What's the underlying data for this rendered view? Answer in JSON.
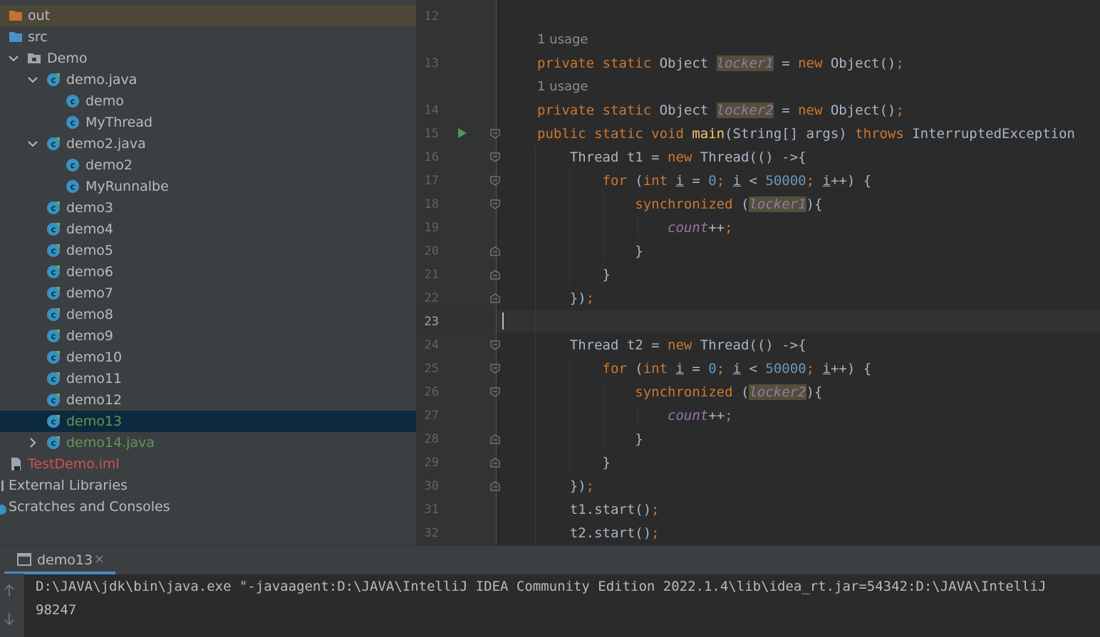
{
  "project_tree": {
    "items": [
      {
        "label": "out",
        "icon": "folder-orange-icon"
      },
      {
        "label": "src",
        "icon": "folder-blue-icon"
      },
      {
        "label": "Demo",
        "icon": "package-icon"
      },
      {
        "label": "demo.java",
        "icon": "java-class-icon"
      },
      {
        "label": "demo",
        "icon": "class-icon"
      },
      {
        "label": "MyThread",
        "icon": "class-icon"
      },
      {
        "label": "demo2.java",
        "icon": "java-class-icon"
      },
      {
        "label": "demo2",
        "icon": "class-icon"
      },
      {
        "label": "MyRunnalbe",
        "icon": "class-icon"
      },
      {
        "label": "demo3",
        "icon": "java-class-icon"
      },
      {
        "label": "demo4",
        "icon": "java-class-icon"
      },
      {
        "label": "demo5",
        "icon": "java-class-icon"
      },
      {
        "label": "demo6",
        "icon": "java-class-icon"
      },
      {
        "label": "demo7",
        "icon": "java-class-icon"
      },
      {
        "label": "demo8",
        "icon": "java-class-icon"
      },
      {
        "label": "demo9",
        "icon": "java-class-icon"
      },
      {
        "label": "demo10",
        "icon": "java-class-icon"
      },
      {
        "label": "demo11",
        "icon": "java-class-icon"
      },
      {
        "label": "demo12",
        "icon": "java-class-icon"
      },
      {
        "label": "demo13",
        "icon": "java-class-icon"
      },
      {
        "label": "demo14.java",
        "icon": "java-class-icon"
      },
      {
        "label": "TestDemo.iml",
        "icon": "iml-file-icon"
      },
      {
        "label": "External Libraries",
        "icon": "libraries-icon"
      },
      {
        "label": "Scratches and Consoles",
        "icon": "scratches-icon"
      }
    ]
  },
  "colors": {
    "tree_bg": "#3c3f41",
    "editor_bg": "#2b2b2b",
    "keyword": "#cc7832",
    "number": "#6897bb",
    "field": "#9876aa",
    "function": "#ffc66d",
    "selection": "#0d293e",
    "modified_file": "#629755",
    "error_file": "#d25252"
  },
  "editor": {
    "usage_hint": "1 usage",
    "line_numbers": [
      "12",
      "13",
      "14",
      "15",
      "16",
      "17",
      "18",
      "19",
      "20",
      "21",
      "22",
      "23",
      "24",
      "25",
      "26",
      "27",
      "28",
      "29",
      "30",
      "31",
      "32"
    ],
    "current_line": "23"
  },
  "run_panel": {
    "tab_label": "demo13",
    "console_lines": [
      "D:\\JAVA\\jdk\\bin\\java.exe \"-javaagent:D:\\JAVA\\IntelliJ IDEA Community Edition 2022.1.4\\lib\\idea_rt.jar=54342:D:\\JAVA\\IntelliJ",
      "98247"
    ]
  }
}
